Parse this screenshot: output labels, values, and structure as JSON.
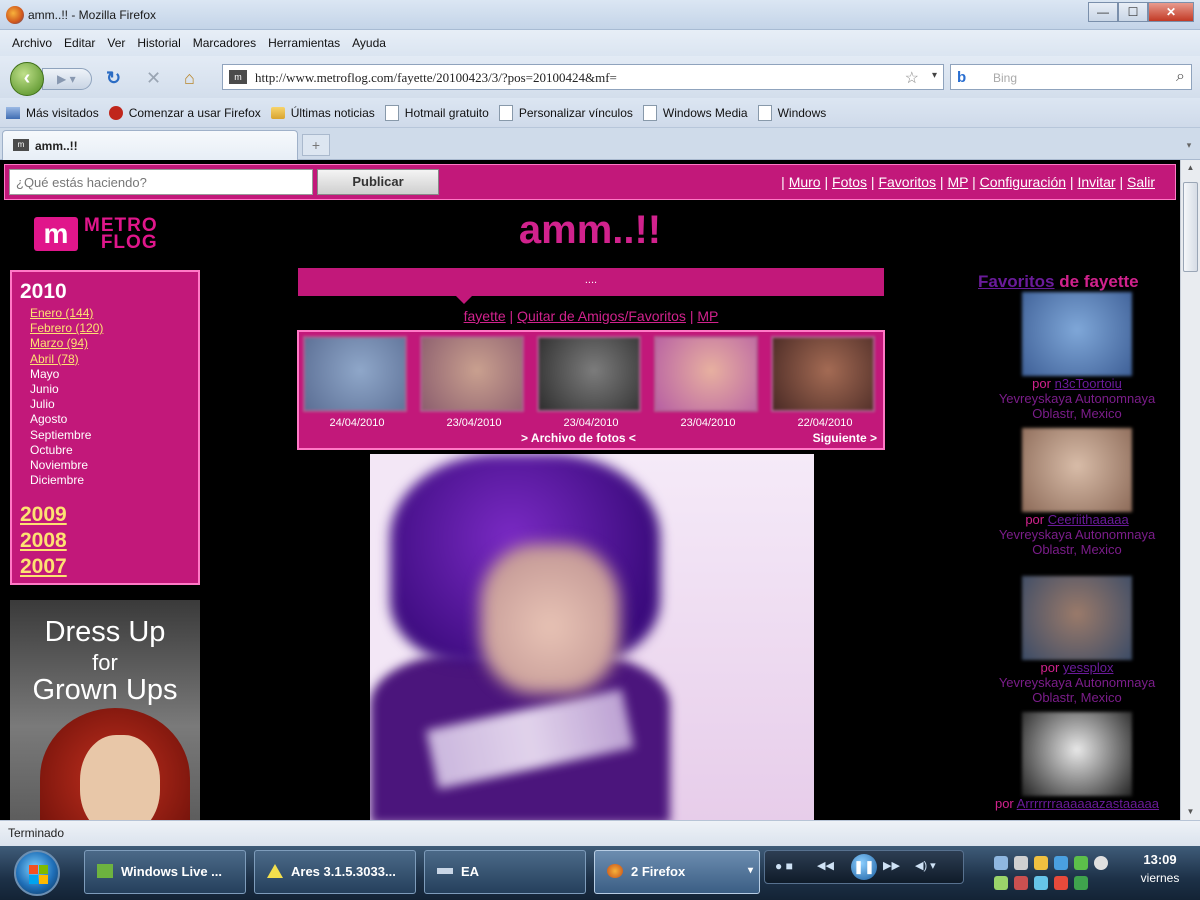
{
  "window": {
    "title": "amm..!! - Mozilla Firefox",
    "min_label": "—",
    "max_label": "☐",
    "close_label": "✕"
  },
  "menu": [
    "Archivo",
    "Editar",
    "Ver",
    "Historial",
    "Marcadores",
    "Herramientas",
    "Ayuda"
  ],
  "navbar": {
    "back_icon": "back-arrow-icon",
    "forward_icon": "forward-arrow-icon",
    "url": "http://www.metroflog.com/fayette/20100423/3/?pos=20100424&mf=",
    "search_engine": "b",
    "search_placeholder": "Bing"
  },
  "bookmarks": [
    "Más visitados",
    "Comenzar a usar Firefox",
    "Últimas noticias",
    "Hotmail gratuito",
    "Personalizar vínculos",
    "Windows Media",
    "Windows"
  ],
  "tabs": [
    {
      "label": "amm..!!",
      "active": true
    }
  ],
  "site": {
    "status_placeholder": "¿Qué estás haciendo?",
    "publish_label": "Publicar",
    "top_links": [
      "Muro",
      "Fotos",
      "Favoritos",
      "MP",
      "Configuración",
      "Invitar",
      "Salir"
    ],
    "logo_text_1": "METRO",
    "logo_text_2": "FLOG",
    "logo_mark": "m",
    "heading": "amm..!!",
    "dots": "....",
    "user_link": "fayette",
    "remove_link": "Quitar de Amigos/Favoritos",
    "mp_link": "MP",
    "archive": {
      "current_year": "2010",
      "months": [
        {
          "label": "Enero (144)",
          "link": true
        },
        {
          "label": "Febrero (120)",
          "link": true
        },
        {
          "label": "Marzo (94)",
          "link": true
        },
        {
          "label": "Abril (78)",
          "link": true
        },
        {
          "label": "Mayo",
          "link": false
        },
        {
          "label": "Junio",
          "link": false
        },
        {
          "label": "Julio",
          "link": false
        },
        {
          "label": "Agosto",
          "link": false
        },
        {
          "label": "Septiembre",
          "link": false
        },
        {
          "label": "Octubre",
          "link": false
        },
        {
          "label": "Noviembre",
          "link": false
        },
        {
          "label": "Diciembre",
          "link": false
        }
      ],
      "past_years": [
        "2009",
        "2008",
        "2007"
      ]
    },
    "ad_lines": [
      "Dress Up",
      "for",
      "Grown Ups"
    ],
    "photos": [
      {
        "date": "24/04/2010",
        "color_a": "#8fa7c9",
        "color_b": "#5b6e94"
      },
      {
        "date": "23/04/2010",
        "color_a": "#c9a08f",
        "color_b": "#8c5e6e"
      },
      {
        "date": "23/04/2010",
        "color_a": "#7c7c7c",
        "color_b": "#2e2e2e"
      },
      {
        "date": "23/04/2010",
        "color_a": "#e7b0a0",
        "color_b": "#b75fa3"
      },
      {
        "date": "22/04/2010",
        "color_a": "#a46b54",
        "color_b": "#4a2a25"
      }
    ],
    "archive_link": "> Archivo de fotos <",
    "next_link": "Siguiente >",
    "favorites_title_link": "Favoritos",
    "favorites_title_rest": " de fayette",
    "favorites": [
      {
        "por": "por",
        "user": "n3cToortoiu",
        "location": "Yevreyskaya Autonomnaya Oblastr, Mexico",
        "color_a": "#7fa7d8",
        "color_b": "#3e5f96"
      },
      {
        "por": "por",
        "user": "Ceeriithaaaaa",
        "location": "Yevreyskaya Autonomnaya Oblastr, Mexico",
        "color_a": "#d8bca8",
        "color_b": "#8c6a58"
      },
      {
        "por": "por",
        "user": "yessplox",
        "location": "Yevreyskaya Autonomnaya Oblastr, Mexico",
        "color_a": "#9a7a6a",
        "color_b": "#3b4b66"
      },
      {
        "por": "por",
        "user": "Arrrrrrraaaaaazastaaaaa",
        "location": "",
        "color_a": "#e8e8e8",
        "color_b": "#222222"
      }
    ]
  },
  "status_text": "Terminado",
  "taskbar": {
    "tasks": [
      "Windows Live ...",
      "Ares 3.1.5.3033...",
      "EA",
      "2 Firefox"
    ],
    "time": "13:09",
    "day": "viernes"
  }
}
